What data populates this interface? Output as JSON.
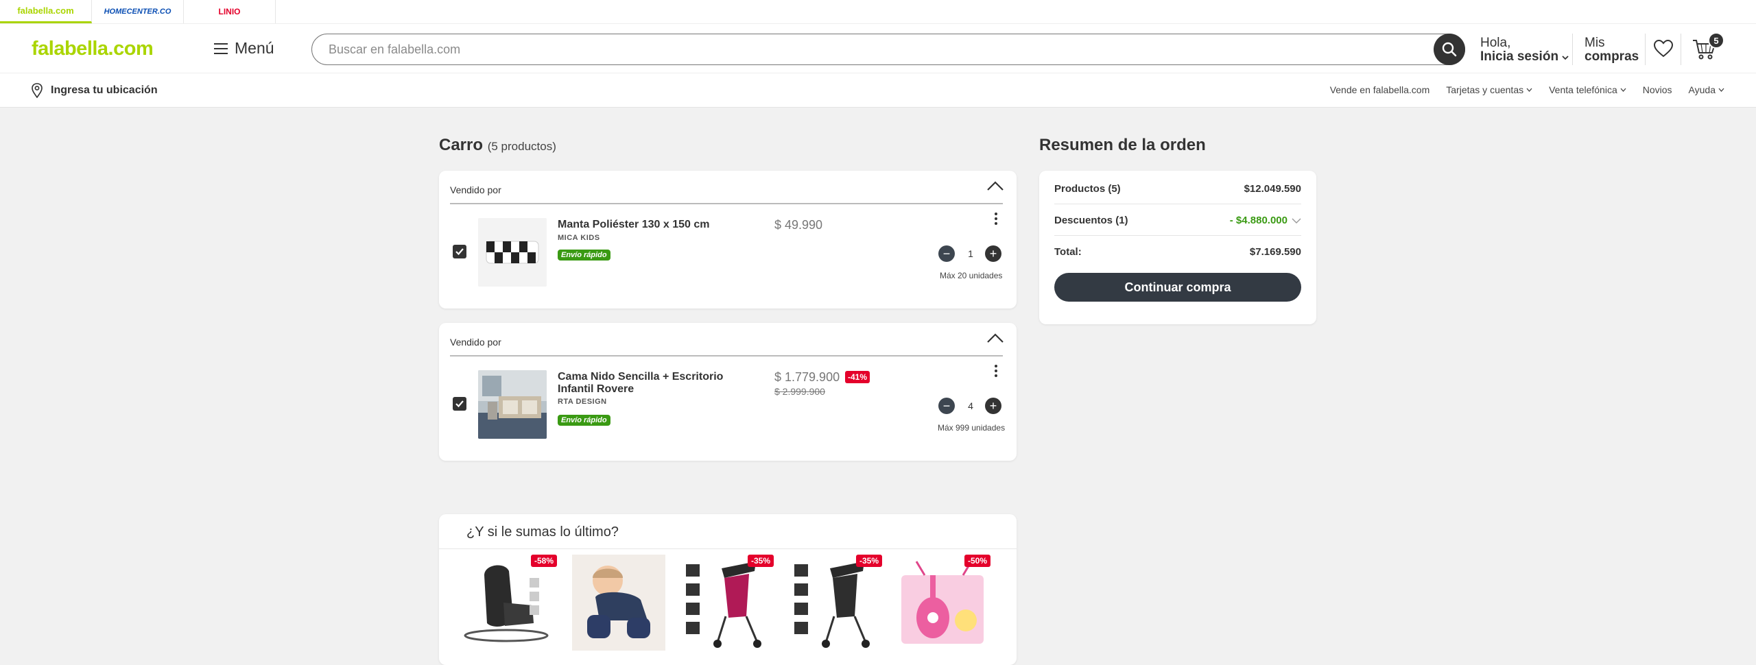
{
  "top_strip": {
    "brands": [
      "falabella.com",
      "HOMECENTER.CO",
      "LINIO"
    ]
  },
  "header": {
    "logo": "falabella.com",
    "menu_label": "Menú",
    "search_placeholder": "Buscar en falabella.com",
    "greeting_line1": "Hola,",
    "greeting_line2": "Inicia sesión",
    "purchases_line1": "Mis",
    "purchases_line2": "compras",
    "cart_count": "5"
  },
  "subbar": {
    "location": "Ingresa tu ubicación",
    "links": [
      "Vende en falabella.com",
      "Tarjetas y cuentas",
      "Venta telefónica",
      "Novios",
      "Ayuda"
    ]
  },
  "cart": {
    "title": "Carro",
    "count_label": "(5 productos)",
    "groups": [
      {
        "seller_label": "Vendido por",
        "item": {
          "name": "Manta Poliéster 130 x 150 cm",
          "brand": "MICA KIDS",
          "tag": "Envío rápido",
          "price": "$ 49.990",
          "quantity": "1",
          "max": "Máx 20 unidades"
        }
      },
      {
        "seller_label": "Vendido por",
        "item": {
          "name": "Cama Nido Sencilla + Escritorio Infantil Rovere",
          "brand": "RTA DESIGN",
          "tag": "Envío rápido",
          "price": "$ 1.779.900",
          "old_price": "$ 2.999.900",
          "discount": "-41%",
          "quantity": "4",
          "max": "Máx 999 unidades"
        }
      }
    ]
  },
  "summary": {
    "title": "Resumen de la orden",
    "products_label": "Productos (5)",
    "products_value": "$12.049.590",
    "discounts_label": "Descuentos (1)",
    "discounts_value": "- $4.880.000",
    "total_label": "Total:",
    "total_value": "$7.169.590",
    "cta": "Continuar compra"
  },
  "recommendations": {
    "title": "¿Y si le sumas lo último?",
    "items": [
      {
        "icon": "car-seat-image",
        "badge": "-58%"
      },
      {
        "icon": "baby-knee-pads-image",
        "badge": ""
      },
      {
        "icon": "stroller-pink-image",
        "badge": "-35%"
      },
      {
        "icon": "stroller-black-image",
        "badge": "-35%"
      },
      {
        "icon": "toy-guitar-image",
        "badge": "-50%"
      }
    ]
  },
  "colors": {
    "brand_green": "#aad500",
    "dark": "#333a43",
    "discount_red": "#e4002b",
    "tag_green": "#3a9a13",
    "discount_text": "#3a9a13"
  }
}
